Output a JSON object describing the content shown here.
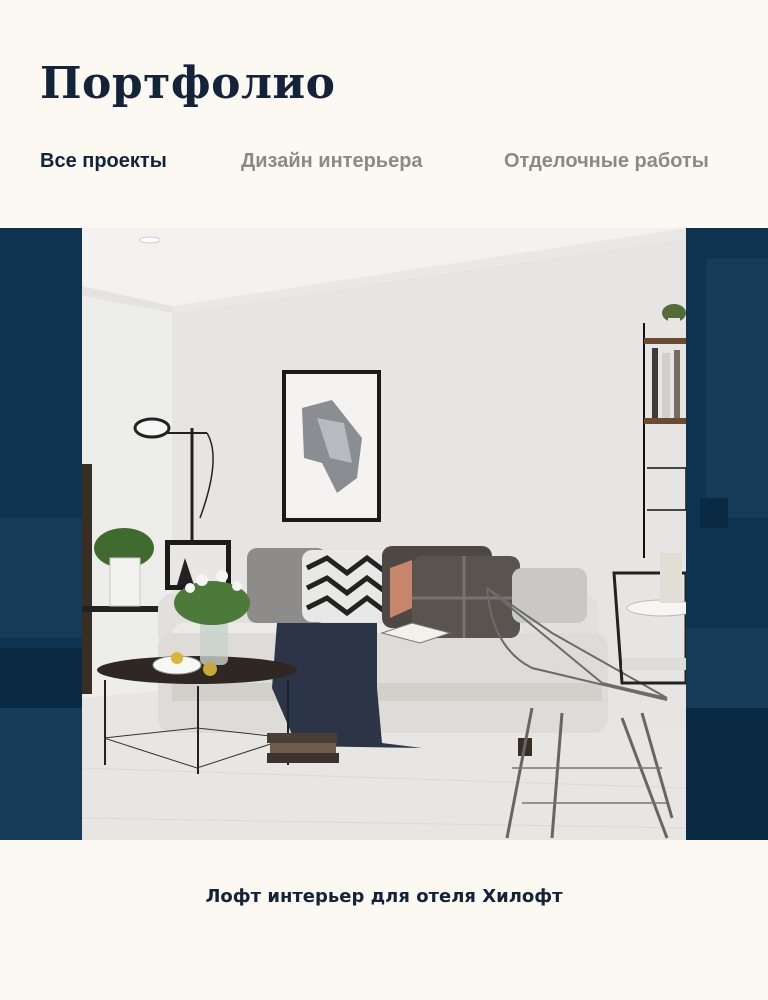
{
  "header": {
    "title": "Портфолио"
  },
  "tabs": [
    {
      "label": "Все проекты",
      "active": true
    },
    {
      "label": "Дизайн интерьера",
      "active": false
    },
    {
      "label": "Отделочные работы",
      "active": false
    }
  ],
  "gallery": {
    "current_caption": "Лофт интерьер для отеля Хилофт",
    "accent_color": "#0e3350"
  }
}
